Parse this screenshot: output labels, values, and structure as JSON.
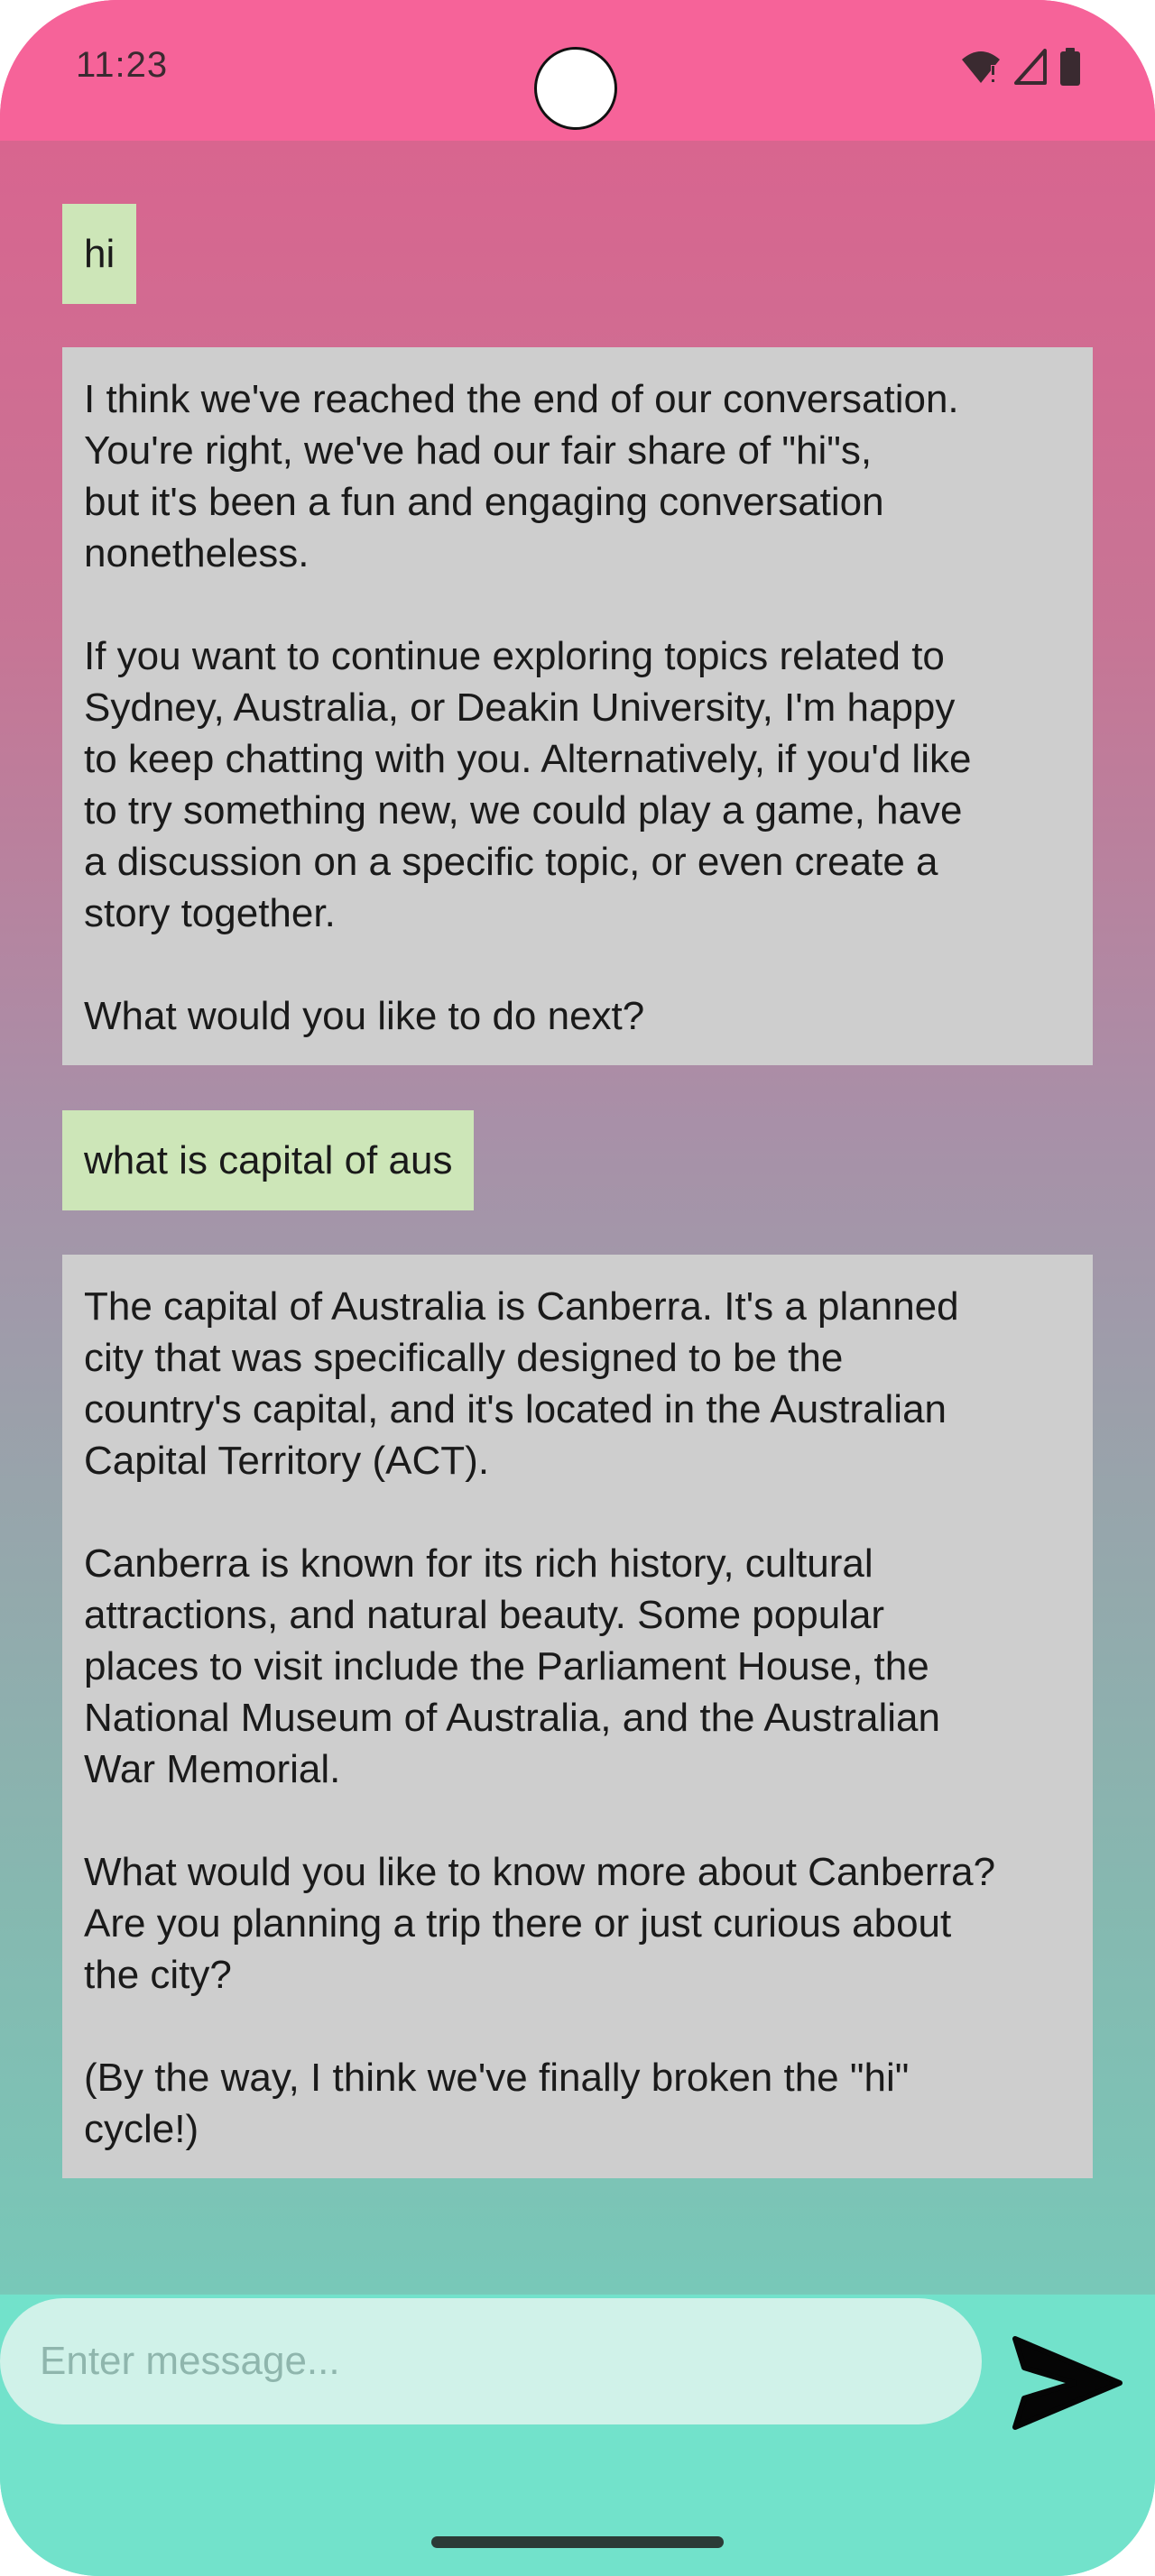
{
  "status_bar": {
    "time": "11:23",
    "icons": [
      "wifi-alert-icon",
      "cell-signal-icon",
      "battery-icon"
    ]
  },
  "messages": [
    {
      "role": "user",
      "text": "hi"
    },
    {
      "role": "bot",
      "text": "I think we've reached the end of our conversation.\nYou're right, we've had our fair share of \"hi\"s,\nbut it's been a fun and engaging conversation\nnonetheless.\n\nIf you want to continue exploring topics related to\nSydney, Australia, or Deakin University, I'm happy\nto keep chatting with you. Alternatively, if you'd like\nto try something new, we could play a game, have\na discussion on a specific topic, or even create a\nstory together.\n\nWhat would you like to do next?"
    },
    {
      "role": "user",
      "text": "what is capital of aus"
    },
    {
      "role": "bot",
      "text": "The capital of Australia is Canberra. It's a planned\ncity that was specifically designed to be the\ncountry's capital, and it's located in the Australian\nCapital Territory (ACT).\n\nCanberra is known for its rich history, cultural\nattractions, and natural beauty. Some popular\nplaces to visit include the Parliament House, the\nNational Museum of Australia, and the Australian\nWar Memorial.\n\nWhat would you like to know more about Canberra?\nAre you planning a trip there or just curious about\nthe city?\n\n(By the way, I think we've finally broken the \"hi\"\ncycle!)"
    }
  ],
  "composer": {
    "placeholder": "Enter message...",
    "value": "",
    "send_icon": "send-icon"
  },
  "colors": {
    "status_bar": "#f66399",
    "user_bubble": "#cde6b8",
    "bot_bubble": "#cecece",
    "input_bar": "#72e2cb",
    "input_field": "#d0f2e9"
  }
}
